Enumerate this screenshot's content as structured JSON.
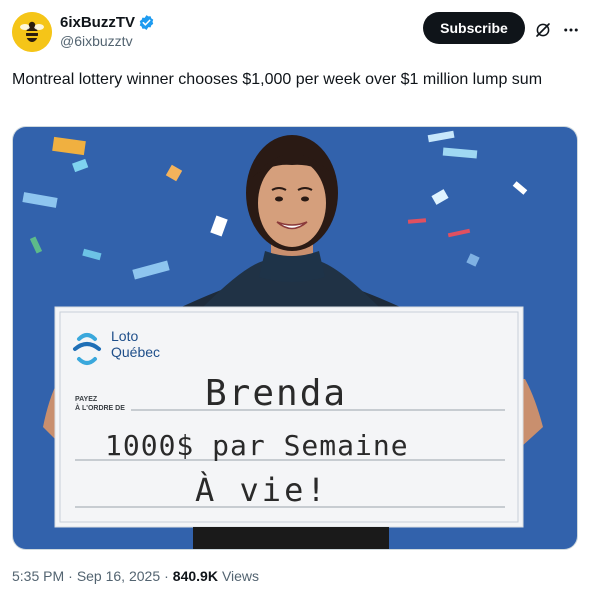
{
  "author": {
    "display_name": "6ixBuzzTV",
    "handle": "@6ixbuzztv"
  },
  "header": {
    "subscribe_label": "Subscribe"
  },
  "post": {
    "text": "Montreal lottery winner chooses $1,000 per week over $1 million lump sum"
  },
  "media": {
    "cheque": {
      "brand_line1": "Loto",
      "brand_line2": "Québec",
      "payee_label_line1": "PAYEZ",
      "payee_label_line2": "À L'ORDRE DE",
      "handwriting_line1": "Brenda",
      "handwriting_line2": "1000$ par Semaine",
      "handwriting_line3": "À vie!"
    }
  },
  "meta": {
    "time": "5:35 PM",
    "sep1": "·",
    "date": "Sep 16, 2025",
    "sep2": "·",
    "views_count": "840.9K",
    "views_label": "Views"
  },
  "colors": {
    "background_blue": "#2f5fa8",
    "verified_badge": "#1d9bf0"
  }
}
